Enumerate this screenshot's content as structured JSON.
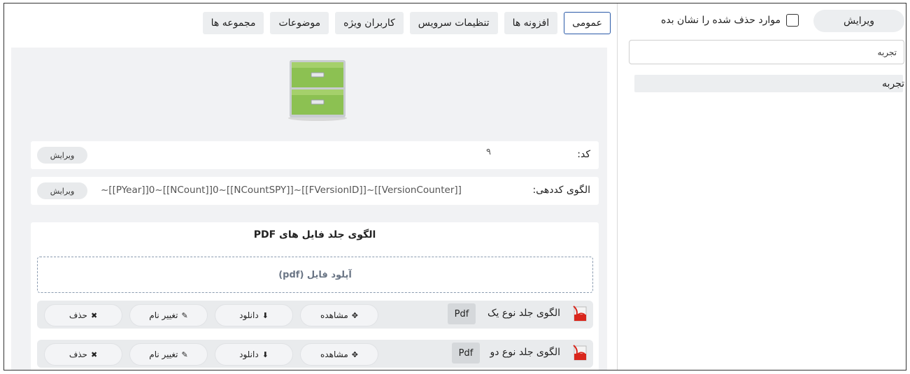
{
  "sidebar": {
    "edit_button": "ویرایش",
    "show_deleted_label": "موارد حذف شده را نشان بده",
    "search_value": "تجربه",
    "tree_item": "تجربه"
  },
  "tabs": [
    {
      "label": "عمومی",
      "active": true
    },
    {
      "label": "افزونه ها",
      "active": false
    },
    {
      "label": "تنظیمات سرویس",
      "active": false
    },
    {
      "label": "کاربران ویژه",
      "active": false
    },
    {
      "label": "موضوعات",
      "active": false
    },
    {
      "label": "مجموعه ها",
      "active": false
    }
  ],
  "code_row": {
    "label": "کد:",
    "value": "۹",
    "edit_button": "ویرایش"
  },
  "pattern_row": {
    "label": "الگوی کددهی:",
    "value": "~[[PYear]]0~[[NCount]]0~[[NCountSPY]]~[[FVersionID]]~[[VersionCounter]]",
    "edit_button": "ویرایش"
  },
  "pdf_section": {
    "title": "الگوی جلد فایل های PDF",
    "upload_label": "آپلود فایل (pdf)",
    "files": [
      {
        "name": "الگوی جلد نوع یک",
        "ext": "Pdf"
      },
      {
        "name": "الگوی جلد نوع دو",
        "ext": "Pdf"
      }
    ],
    "actions": {
      "view": "مشاهده",
      "download": "دانلود",
      "rename": "تغییر نام",
      "delete": "حذف"
    }
  },
  "colors": {
    "active_tab_border": "#2a5aa8",
    "panel_bg": "#f1f2f4",
    "cabinet_green": "#8cc152",
    "pdf_red": "#d9261c"
  }
}
